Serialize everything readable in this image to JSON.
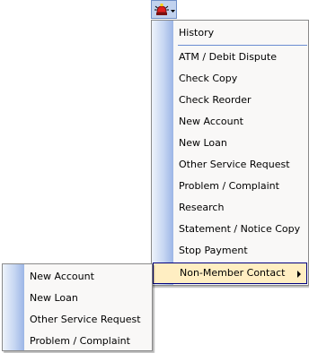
{
  "toolbar": {
    "icon": "red-alert-bell-icon",
    "dropdown_icon": "dropdown-arrow-icon"
  },
  "menu": {
    "items": [
      {
        "label": "History"
      },
      {
        "label": "ATM / Debit Dispute"
      },
      {
        "label": "Check Copy"
      },
      {
        "label": "Check Reorder"
      },
      {
        "label": "New Account"
      },
      {
        "label": "New Loan"
      },
      {
        "label": "Other Service Request"
      },
      {
        "label": "Problem / Complaint"
      },
      {
        "label": "Research"
      },
      {
        "label": "Statement / Notice Copy"
      },
      {
        "label": "Stop Payment"
      },
      {
        "label": "Non-Member Contact",
        "has_submenu": true,
        "highlighted": true
      }
    ]
  },
  "submenu": {
    "items": [
      {
        "label": "New Account"
      },
      {
        "label": "New Loan"
      },
      {
        "label": "Other Service Request"
      },
      {
        "label": "Problem / Complaint"
      }
    ]
  },
  "colors": {
    "highlight": "#ffeec2",
    "highlight_border": "#000080",
    "gutter": "#9cb6e6",
    "menu_bg": "#f9f8f7"
  }
}
